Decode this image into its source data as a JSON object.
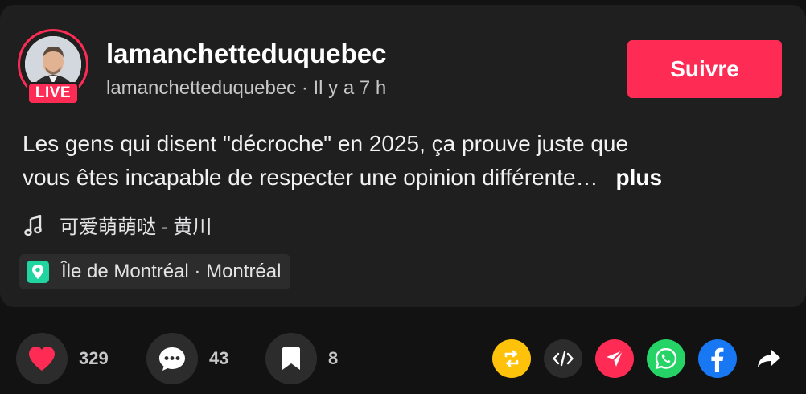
{
  "post": {
    "username": "lamanchetteduquebec",
    "subline": "lamanchetteduquebec · Il y a 7 h",
    "live_label": "LIVE",
    "follow_label": "Suivre",
    "caption_line1": "Les gens qui disent \"décroche\" en 2025, ça prouve juste que",
    "caption_line2": "vous êtes incapable de respecter une opinion différente…",
    "more_label": "plus",
    "music": "可爱萌萌哒 - 黄川",
    "location": "Île de Montréal · Montréal"
  },
  "actions": {
    "likes": "329",
    "comments": "43",
    "saves": "8"
  },
  "share": {
    "icons": [
      "repost-icon",
      "embed-icon",
      "send-icon",
      "whatsapp-icon",
      "facebook-icon",
      "share-arrow-icon"
    ]
  },
  "colors": {
    "accent": "#fe2c55",
    "background": "#121212",
    "card": "#1f1f1f",
    "repost": "#ffc20a",
    "whatsapp": "#25d366",
    "facebook": "#1877f2",
    "location_pin": "#20d5a0"
  }
}
